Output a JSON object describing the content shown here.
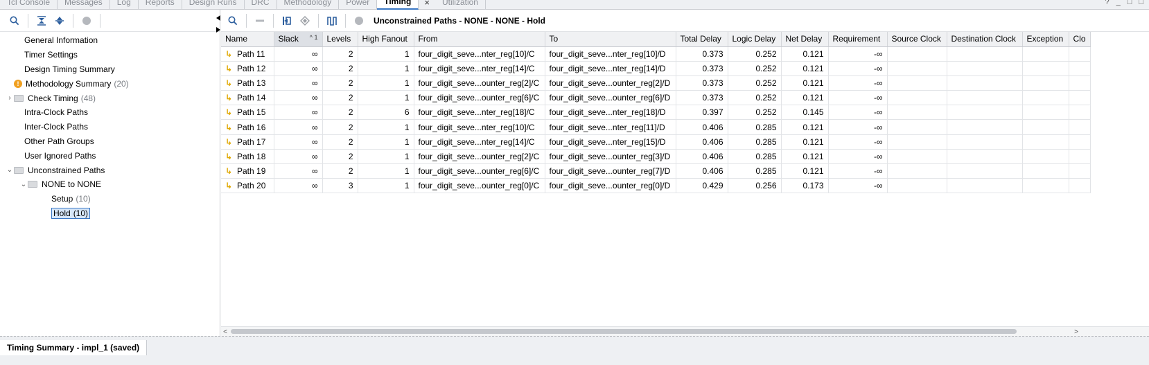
{
  "tabs": [
    {
      "label": "Tcl Console",
      "active": false
    },
    {
      "label": "Messages",
      "active": false
    },
    {
      "label": "Log",
      "active": false
    },
    {
      "label": "Reports",
      "active": false
    },
    {
      "label": "Design Runs",
      "active": false
    },
    {
      "label": "DRC",
      "active": false
    },
    {
      "label": "Methodology",
      "active": false
    },
    {
      "label": "Power",
      "active": false
    },
    {
      "label": "Timing",
      "active": true
    },
    {
      "label": "Utilization",
      "active": false
    }
  ],
  "window_controls": [
    "?",
    "_",
    "□",
    "□"
  ],
  "tree": [
    {
      "label": "General Information",
      "indent": 1,
      "count": ""
    },
    {
      "label": "Timer Settings",
      "indent": 1,
      "count": ""
    },
    {
      "label": "Design Timing Summary",
      "indent": 1,
      "count": ""
    },
    {
      "label": "Methodology Summary",
      "indent": 1,
      "count": "(20)",
      "icon": "warning-icon"
    },
    {
      "label": "Check Timing",
      "indent": 1,
      "count": "(48)",
      "icon": "folder-icon",
      "chevron": ">"
    },
    {
      "label": "Intra-Clock Paths",
      "indent": 1,
      "count": ""
    },
    {
      "label": "Inter-Clock Paths",
      "indent": 1,
      "count": ""
    },
    {
      "label": "Other Path Groups",
      "indent": 1,
      "count": ""
    },
    {
      "label": "User Ignored Paths",
      "indent": 1,
      "count": ""
    },
    {
      "label": "Unconstrained Paths",
      "indent": 1,
      "count": "",
      "icon": "folder-icon",
      "chevron": "v"
    },
    {
      "label": "NONE to NONE",
      "indent": 2,
      "count": "",
      "icon": "folder-icon",
      "chevron": "v"
    },
    {
      "label": "Setup",
      "indent": 3,
      "count": "(10)"
    },
    {
      "label": "Hold",
      "indent": 3,
      "count": "(10)",
      "selected": true
    }
  ],
  "panel_title": "Unconstrained Paths - NONE - NONE - Hold",
  "columns": [
    "Name",
    "Slack",
    "Levels",
    "High Fanout",
    "From",
    "To",
    "Total Delay",
    "Logic Delay",
    "Net Delay",
    "Requirement",
    "Source Clock",
    "Destination Clock",
    "Exception",
    "Clo"
  ],
  "sort_indicator": "^ 1",
  "rows": [
    [
      "Path 11",
      "∞",
      "2",
      "1",
      "four_digit_seve...nter_reg[10]/C",
      "four_digit_seve...nter_reg[10]/D",
      "0.373",
      "0.252",
      "0.121",
      "-∞",
      "",
      "",
      "",
      ""
    ],
    [
      "Path 12",
      "∞",
      "2",
      "1",
      "four_digit_seve...nter_reg[14]/C",
      "four_digit_seve...nter_reg[14]/D",
      "0.373",
      "0.252",
      "0.121",
      "-∞",
      "",
      "",
      "",
      ""
    ],
    [
      "Path 13",
      "∞",
      "2",
      "1",
      "four_digit_seve...ounter_reg[2]/C",
      "four_digit_seve...ounter_reg[2]/D",
      "0.373",
      "0.252",
      "0.121",
      "-∞",
      "",
      "",
      "",
      ""
    ],
    [
      "Path 14",
      "∞",
      "2",
      "1",
      "four_digit_seve...ounter_reg[6]/C",
      "four_digit_seve...ounter_reg[6]/D",
      "0.373",
      "0.252",
      "0.121",
      "-∞",
      "",
      "",
      "",
      ""
    ],
    [
      "Path 15",
      "∞",
      "2",
      "6",
      "four_digit_seve...nter_reg[18]/C",
      "four_digit_seve...nter_reg[18]/D",
      "0.397",
      "0.252",
      "0.145",
      "-∞",
      "",
      "",
      "",
      ""
    ],
    [
      "Path 16",
      "∞",
      "2",
      "1",
      "four_digit_seve...nter_reg[10]/C",
      "four_digit_seve...nter_reg[11]/D",
      "0.406",
      "0.285",
      "0.121",
      "-∞",
      "",
      "",
      "",
      ""
    ],
    [
      "Path 17",
      "∞",
      "2",
      "1",
      "four_digit_seve...nter_reg[14]/C",
      "four_digit_seve...nter_reg[15]/D",
      "0.406",
      "0.285",
      "0.121",
      "-∞",
      "",
      "",
      "",
      ""
    ],
    [
      "Path 18",
      "∞",
      "2",
      "1",
      "four_digit_seve...ounter_reg[2]/C",
      "four_digit_seve...ounter_reg[3]/D",
      "0.406",
      "0.285",
      "0.121",
      "-∞",
      "",
      "",
      "",
      ""
    ],
    [
      "Path 19",
      "∞",
      "2",
      "1",
      "four_digit_seve...ounter_reg[6]/C",
      "four_digit_seve...ounter_reg[7]/D",
      "0.406",
      "0.285",
      "0.121",
      "-∞",
      "",
      "",
      "",
      ""
    ],
    [
      "Path 20",
      "∞",
      "3",
      "1",
      "four_digit_seve...ounter_reg[0]/C",
      "four_digit_seve...ounter_reg[0]/D",
      "0.429",
      "0.256",
      "0.173",
      "-∞",
      "",
      "",
      "",
      ""
    ]
  ],
  "bottom_tab": "Timing Summary - impl_1 (saved)",
  "colors": {
    "accent": "#3b78c5",
    "path_icon": "#e0a800",
    "warning": "#f0a020"
  }
}
